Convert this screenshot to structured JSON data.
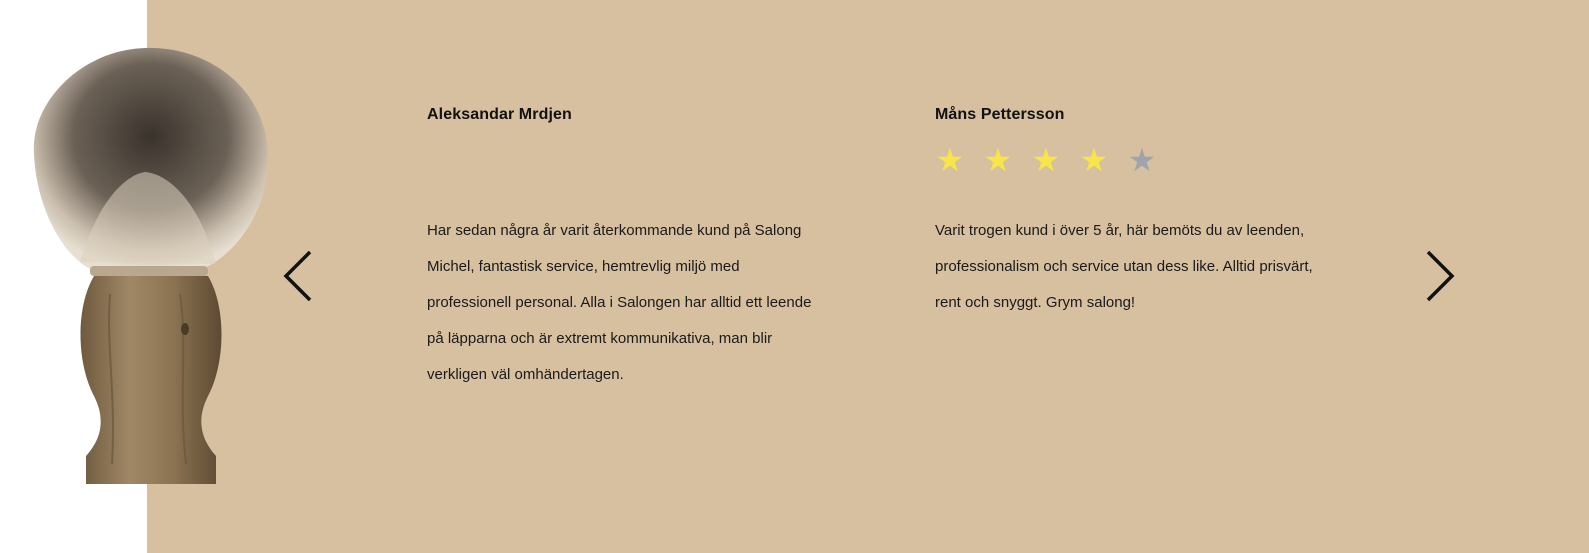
{
  "navigation": {
    "prev_icon": "chevron-left-icon",
    "next_icon": "chevron-right-icon"
  },
  "image": {
    "subject": "shaving-brush",
    "icon": "shaving-brush-image"
  },
  "reviews": [
    {
      "name": "Aleksandar Mrdjen",
      "rating": null,
      "text": "Har sedan några år varit återkommande kund på Salong Michel, fantastisk service, hemtrevlig miljö med professionell personal. Alla i Salongen har alltid ett leende på läpparna och är extremt kommunikativa, man blir verkligen väl omhändertagen."
    },
    {
      "name": "Måns Pettersson",
      "rating": 4,
      "rating_max": 5,
      "text": "Varit trogen kund i över 5 år, här bemöts du av leenden, professionalism och service utan dess like. Alltid prisvärt, rent och snyggt. Grym salong!"
    }
  ],
  "colors": {
    "panel_background": "#d7c0a0",
    "star_filled": "#f7e64a",
    "star_empty": "#9fa3ad",
    "text": "#111111"
  }
}
